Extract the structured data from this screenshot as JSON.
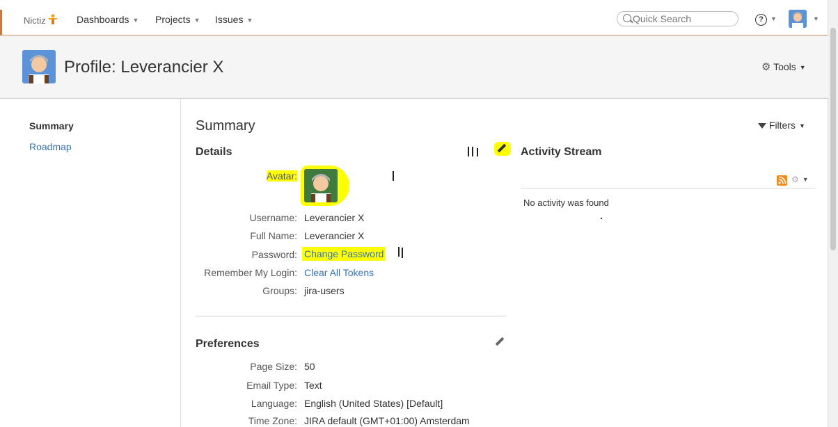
{
  "nav": {
    "logo": "Nictiz",
    "items": [
      "Dashboards",
      "Projects",
      "Issues"
    ],
    "search_placeholder": "Quick Search",
    "help": "?"
  },
  "header": {
    "title": "Profile: Leverancier X",
    "tools": "Tools"
  },
  "sidebar": {
    "items": [
      "Summary",
      "Roadmap"
    ]
  },
  "main": {
    "title": "Summary",
    "filters": "Filters"
  },
  "details": {
    "heading": "Details",
    "avatar_label": "Avatar:",
    "rows": [
      {
        "label": "Username:",
        "value": "Leverancier X"
      },
      {
        "label": "Full Name:",
        "value": "Leverancier X"
      },
      {
        "label": "Password:",
        "value": "Change Password"
      },
      {
        "label": "Remember My Login:",
        "value": "Clear All Tokens"
      },
      {
        "label": "Groups:",
        "value": "jira-users"
      }
    ]
  },
  "preferences": {
    "heading": "Preferences",
    "rows": [
      {
        "label": "Page Size:",
        "value": "50"
      },
      {
        "label": "Email Type:",
        "value": "Text"
      },
      {
        "label": "Language:",
        "value": "English (United States) [Default]"
      },
      {
        "label": "Time Zone:",
        "value": "JIRA default (GMT+01:00) Amsterdam"
      }
    ]
  },
  "activity": {
    "heading": "Activity Stream",
    "empty": "No activity was found"
  },
  "colors": {
    "link": "#3572b0",
    "highlight": "#ffff00",
    "accent": "#c57a45"
  }
}
